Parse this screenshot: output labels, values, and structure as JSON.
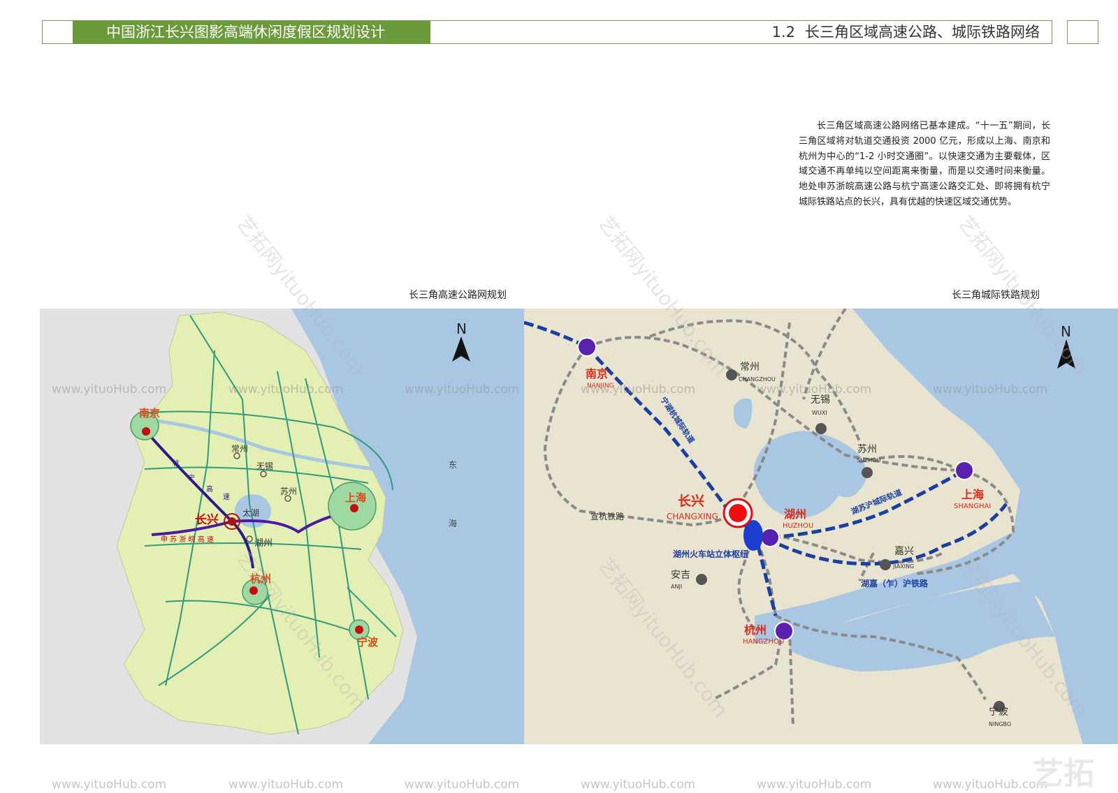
{
  "header": {
    "project_title": "中国浙江长兴图影高端休闲度假区规划设计",
    "section_number": "1.2",
    "section_title": "长三角区域高速公路、城际铁路网络"
  },
  "description": "长三角区域高速公路网络已基本建成。“十一五”期间，长三角区域将对轨道交通投资 2000 亿元，形成以上海、南京和杭州为中心的“1-2 小时交通圈”。以快速交通为主要载体，区域交通不再单纯以空间距离来衡量，而是以交通时间来衡量。地处申苏浙皖高速公路与杭宁高速公路交汇处、即将拥有杭宁城际铁路站点的长兴，具有优越的快速区域交通优势。",
  "highway_map": {
    "title": "长三角高速公路网规划",
    "north": "N",
    "sea_label_1": "东",
    "sea_label_2": "海",
    "lake": "太湖",
    "cities": {
      "nanjing": "南京",
      "changzhou": "常州",
      "wuxi": "无锡",
      "suzhou": "苏州",
      "shanghai": "上海",
      "changxing": "长兴",
      "huzhou": "湖州",
      "hangzhou": "杭州",
      "ningbo": "宁波"
    },
    "hangning_chars": [
      "杭",
      "宁",
      "高",
      "速"
    ],
    "shensu_highway": "申 苏 浙 皖 高 速"
  },
  "railway_map": {
    "title": "长三角城际铁路规划",
    "north": "N",
    "cities": {
      "nanjing": "南京",
      "nanjing_en": "NANJING",
      "changzhou": "常州",
      "changzhou_en": "CHANGZHOU",
      "wuxi": "无锡",
      "wuxi_en": "WUXI",
      "suzhou": "苏州",
      "suzhou_en": "SUZHOU",
      "shanghai": "上海",
      "shanghai_en": "SHANGHAI",
      "changxing": "长兴",
      "changxing_en": "CHANGXING",
      "huzhou": "湖州",
      "huzhou_en": "HUZHOU",
      "jiaxing": "嘉兴",
      "jiaxing_en": "JIAXING",
      "anji": "安吉",
      "anji_en": "ANJI",
      "hangzhou": "杭州",
      "hangzhou_en": "HANGZHOU",
      "ningbo": "宁波",
      "ningbo_en": "NINGBO"
    },
    "lines": {
      "ninghuhang": "宁湖杭城际轨道",
      "husuhu": "湖苏沪城际轨道",
      "xuanhang": "宣杭铁路",
      "hujiahu": "湖嘉（乍）沪铁路",
      "hub": "湖州火车站立体枢纽"
    }
  },
  "watermark": {
    "url": "www.yituoHub.com",
    "diagonal": "艺拓网yituoHub.com",
    "logo": "艺拓"
  },
  "colors": {
    "header_green": "#6a9a3a",
    "highway_land": "#e4efb4",
    "sea": "#a9c7e3",
    "rail_land": "#e9e4cf",
    "city_red": "#d94a1a",
    "station_purple": "#5a20b0",
    "line_blue": "#1a3fa0"
  }
}
